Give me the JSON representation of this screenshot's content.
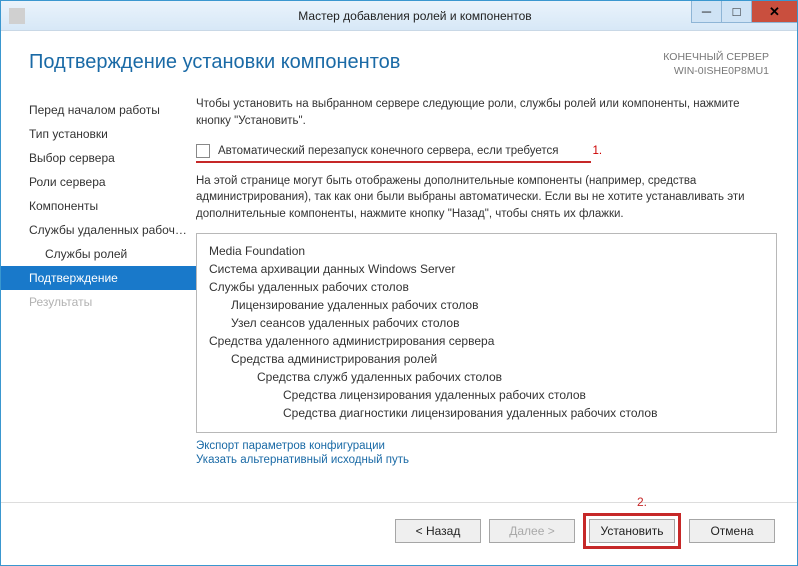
{
  "window": {
    "title": "Мастер добавления ролей и компонентов"
  },
  "header": {
    "pageTitle": "Подтверждение установки компонентов",
    "serverLabel": "КОНЕЧНЫЙ СЕРВЕР",
    "serverName": "WIN-0ISHE0P8MU1"
  },
  "sidebar": {
    "items": [
      {
        "label": "Перед началом работы",
        "state": "normal"
      },
      {
        "label": "Тип установки",
        "state": "normal"
      },
      {
        "label": "Выбор сервера",
        "state": "normal"
      },
      {
        "label": "Роли сервера",
        "state": "normal"
      },
      {
        "label": "Компоненты",
        "state": "normal"
      },
      {
        "label": "Службы удаленных рабочих столов",
        "state": "normal"
      },
      {
        "label": "Службы ролей",
        "state": "sub"
      },
      {
        "label": "Подтверждение",
        "state": "selected"
      },
      {
        "label": "Результаты",
        "state": "disabled"
      }
    ]
  },
  "main": {
    "intro": "Чтобы установить на выбранном сервере следующие роли, службы ролей или компоненты, нажмите кнопку \"Установить\".",
    "checkboxLabel": "Автоматический перезапуск конечного сервера, если требуется",
    "marker1": "1.",
    "note": "На этой странице могут быть отображены дополнительные компоненты (например, средства администрирования), так как они были выбраны автоматически. Если вы не хотите устанавливать эти дополнительные компоненты, нажмите кнопку \"Назад\", чтобы снять их флажки.",
    "tree": [
      {
        "label": "Media Foundation",
        "level": 0
      },
      {
        "label": "Система архивации данных Windows Server",
        "level": 0
      },
      {
        "label": "Службы удаленных рабочих столов",
        "level": 0
      },
      {
        "label": "Лицензирование удаленных рабочих столов",
        "level": 1
      },
      {
        "label": "Узел сеансов удаленных рабочих столов",
        "level": 1
      },
      {
        "label": "Средства удаленного администрирования сервера",
        "level": 0
      },
      {
        "label": "Средства администрирования ролей",
        "level": 1
      },
      {
        "label": "Средства служб удаленных рабочих столов",
        "level": 2
      },
      {
        "label": "Средства лицензирования удаленных рабочих столов",
        "level": 3
      },
      {
        "label": "Средства диагностики лицензирования удаленных рабочих столов",
        "level": 3
      }
    ],
    "links": {
      "export": "Экспорт параметров конфигурации",
      "altPath": "Указать альтернативный исходный путь"
    }
  },
  "footer": {
    "marker2": "2.",
    "back": "< Назад",
    "next": "Далее >",
    "install": "Установить",
    "cancel": "Отмена"
  }
}
